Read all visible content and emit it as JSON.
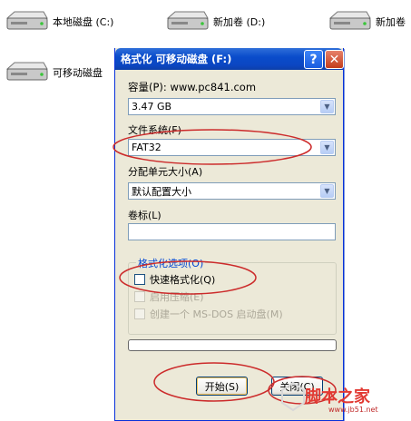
{
  "desktop": {
    "drives": [
      {
        "label": "本地磁盘 (C:)"
      },
      {
        "label": "新加卷 (D:)"
      },
      {
        "label": "新加卷"
      },
      {
        "label": "可移动磁盘"
      }
    ]
  },
  "dialog": {
    "title": "格式化 可移动磁盘 (F:)",
    "help_glyph": "?",
    "close_glyph": "✕",
    "capacity_label": "容量(P): www.pc841.com",
    "capacity_value": "3.47 GB",
    "filesystem_label": "文件系统(F)",
    "filesystem_value": "FAT32",
    "allocation_label": "分配单元大小(A)",
    "allocation_value": "默认配置大小",
    "volume_label_label": "卷标(L)",
    "volume_label_value": "",
    "options_legend": "格式化选项(O)",
    "options": [
      {
        "label": "快速格式化(Q)",
        "checked": false,
        "enabled": true
      },
      {
        "label": "启用压缩(E)",
        "checked": false,
        "enabled": false
      },
      {
        "label": "创建一个 MS-DOS 启动盘(M)",
        "checked": false,
        "enabled": false
      }
    ],
    "start_button": "开始(S)",
    "close_button": "关闭(C)"
  },
  "watermark": {
    "text": "脚本之家",
    "url": "www.jb51.net"
  },
  "colors": {
    "title_bar": "#0b46c1",
    "dialog_bg": "#ece9d8",
    "annotation": "#cc2b2b",
    "watermark": "#e23a33"
  },
  "icons": [
    "hard-drive-icon",
    "help-icon",
    "close-icon",
    "dropdown-arrow-icon",
    "checkbox-icon"
  ]
}
